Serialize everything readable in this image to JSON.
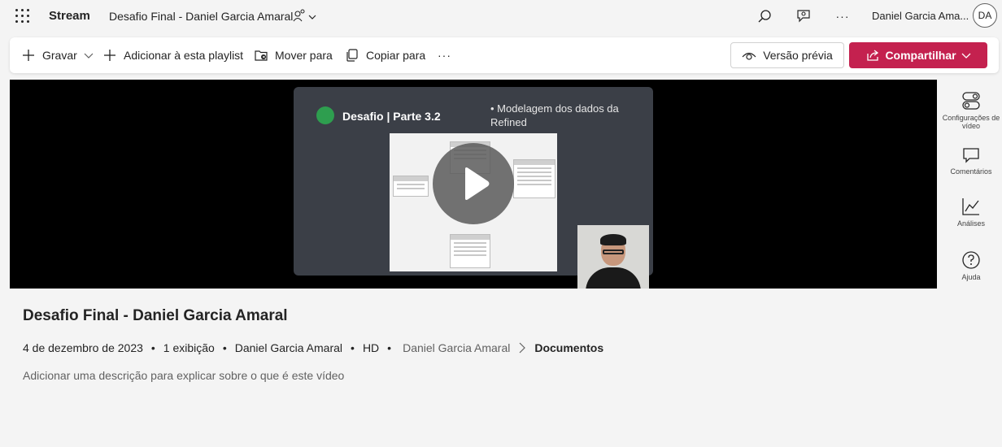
{
  "header": {
    "app_name": "Stream",
    "document_title": "Desafio Final - Daniel Garcia Amaral",
    "user_name": "Daniel Garcia Ama...",
    "user_initials": "DA",
    "icons": [
      "waffle-icon",
      "people-icon",
      "chevron-down-icon",
      "search-icon",
      "feedback-icon",
      "more-icon"
    ]
  },
  "commandbar": {
    "record_label": "Gravar",
    "add_playlist_label": "Adicionar à esta playlist",
    "move_label": "Mover para",
    "copy_label": "Copiar para",
    "more_label": "···",
    "preview_label": "Versão prévia",
    "share_label": "Compartilhar"
  },
  "video": {
    "slide_heading": "Desafio | Parte 3.2",
    "slide_bullet": "• Modelagem dos dados da Refined"
  },
  "right_pane": {
    "video_settings_label": "Configurações de vídeo",
    "comments_label": "Comentários",
    "analytics_label": "Análises",
    "help_label": "Ajuda"
  },
  "details": {
    "title": "Desafio Final - Daniel Garcia Amaral",
    "date": "4 de dezembro de 2023",
    "views": "1 exibição",
    "owner": "Daniel Garcia Amaral",
    "quality": "HD",
    "location_root": "Daniel Garcia Amaral",
    "location_folder": "Documentos",
    "description_placeholder": "Adicionar uma descrição para explicar sobre o que é este vídeo"
  },
  "colors": {
    "accent": "#c4214f",
    "background": "#f4f4f4"
  }
}
